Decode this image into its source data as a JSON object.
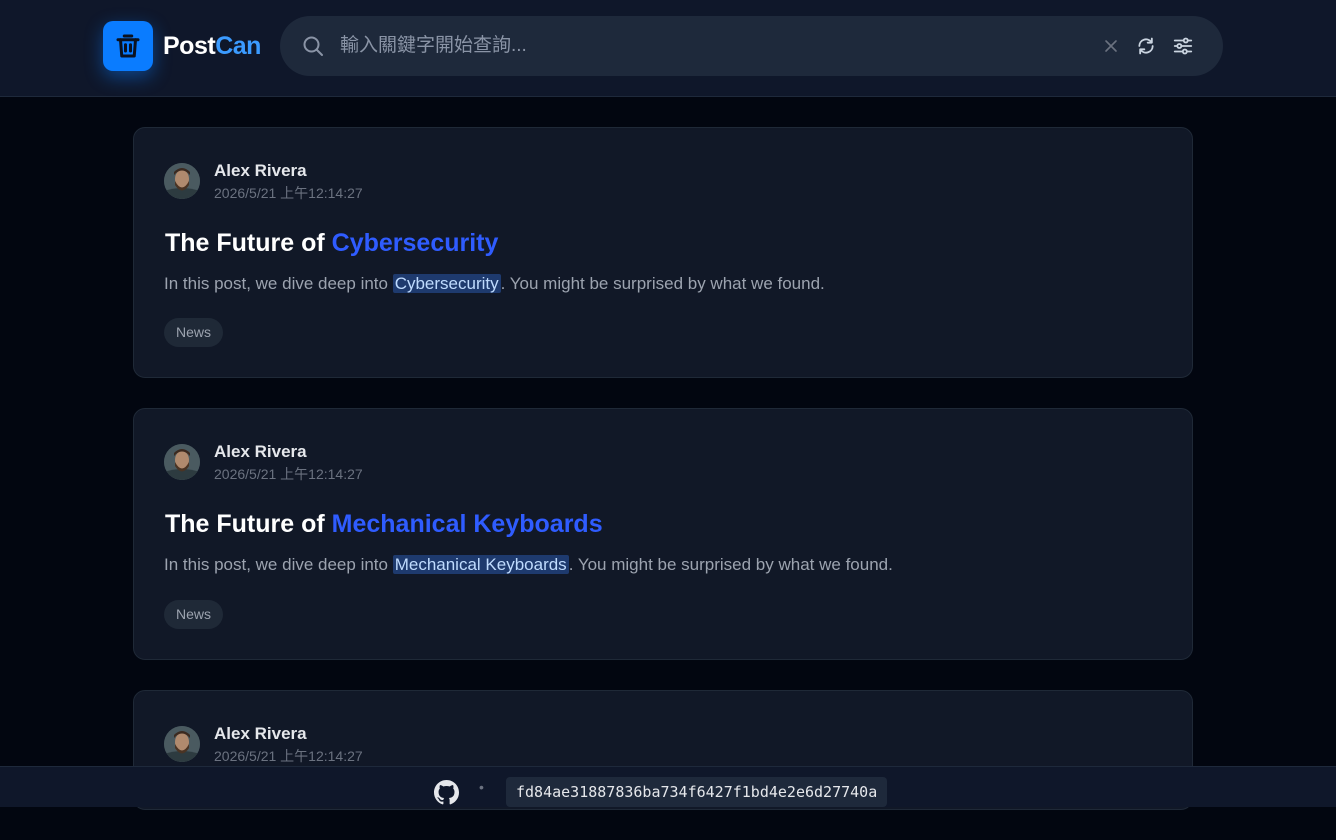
{
  "app": {
    "name_part1": "Post",
    "name_part2": "Can",
    "brand_color": "#0a7cff"
  },
  "search": {
    "placeholder": "輸入關鍵字開始查詢...",
    "value": ""
  },
  "posts": [
    {
      "author": "Alex Rivera",
      "time": "2026/5/21 上午12:14:27",
      "title_prefix": "The Future of ",
      "title_keyword": "Cybersecurity",
      "excerpt_prefix": "In this post, we dive deep into ",
      "excerpt_keyword": "Cybersecurity",
      "excerpt_suffix": ". You might be surprised by what we found.",
      "tag": "News"
    },
    {
      "author": "Alex Rivera",
      "time": "2026/5/21 上午12:14:27",
      "title_prefix": "The Future of ",
      "title_keyword": "Mechanical Keyboards",
      "excerpt_prefix": "In this post, we dive deep into ",
      "excerpt_keyword": "Mechanical Keyboards",
      "excerpt_suffix": ". You might be surprised by what we found.",
      "tag": "News"
    },
    {
      "author": "Alex Rivera",
      "time": "2026/5/21 上午12:14:27"
    }
  ],
  "footer": {
    "separator": "•",
    "commit_hash": "fd84ae31887836ba734f6427f1bd4e2e6d27740a"
  }
}
